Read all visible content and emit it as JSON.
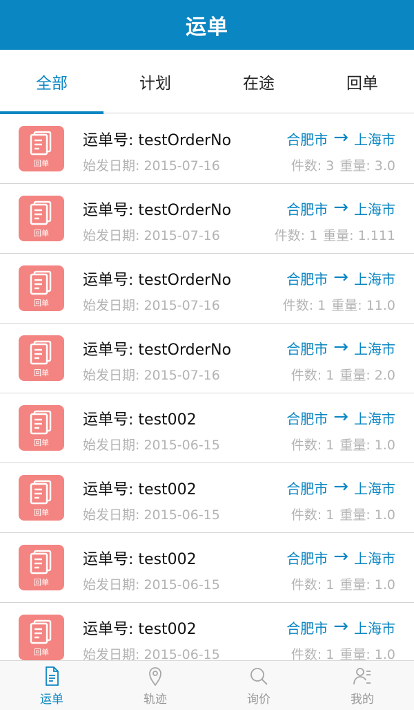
{
  "title": "运单",
  "tabs": [
    {
      "label": "全部",
      "active": true
    },
    {
      "label": "计划",
      "active": false
    },
    {
      "label": "在途",
      "active": false
    },
    {
      "label": "回单",
      "active": false
    }
  ],
  "orders": [
    {
      "icon_label": "回单",
      "order_no": "运单号: testOrderNo",
      "date": "始发日期:  2015-07-16",
      "from": "合肥市",
      "to": "上海市",
      "pieces": "件数: 3",
      "weight": "重量: 3.0"
    },
    {
      "icon_label": "回单",
      "order_no": "运单号: testOrderNo",
      "date": "始发日期:  2015-07-16",
      "from": "合肥市",
      "to": "上海市",
      "pieces": "件数: 1",
      "weight": "重量: 1.111"
    },
    {
      "icon_label": "回单",
      "order_no": "运单号: testOrderNo",
      "date": "始发日期:  2015-07-16",
      "from": "合肥市",
      "to": "上海市",
      "pieces": "件数: 1",
      "weight": "重量: 11.0"
    },
    {
      "icon_label": "回单",
      "order_no": "运单号: testOrderNo",
      "date": "始发日期:  2015-07-16",
      "from": "合肥市",
      "to": "上海市",
      "pieces": "件数: 1",
      "weight": "重量: 2.0"
    },
    {
      "icon_label": "回单",
      "order_no": "运单号: test002",
      "date": "始发日期:  2015-06-15",
      "from": "合肥市",
      "to": "上海市",
      "pieces": "件数: 1",
      "weight": "重量: 1.0"
    },
    {
      "icon_label": "回单",
      "order_no": "运单号: test002",
      "date": "始发日期:  2015-06-15",
      "from": "合肥市",
      "to": "上海市",
      "pieces": "件数: 1",
      "weight": "重量: 1.0"
    },
    {
      "icon_label": "回单",
      "order_no": "运单号: test002",
      "date": "始发日期:  2015-06-15",
      "from": "合肥市",
      "to": "上海市",
      "pieces": "件数: 1",
      "weight": "重量: 1.0"
    },
    {
      "icon_label": "回单",
      "order_no": "运单号: test002",
      "date": "始发日期:  2015-06-15",
      "from": "合肥市",
      "to": "上海市",
      "pieces": "件数: 1",
      "weight": "重量: 1.0"
    }
  ],
  "route_arrow": "→",
  "bottom_nav": [
    {
      "label": "运单",
      "icon": "document-icon",
      "active": true
    },
    {
      "label": "轨迹",
      "icon": "location-pin-icon",
      "active": false
    },
    {
      "label": "询价",
      "icon": "search-icon",
      "active": false
    },
    {
      "label": "我的",
      "icon": "user-profile-icon",
      "active": false
    }
  ],
  "colors": {
    "primary": "#0a86c2",
    "icon_bg": "#f38481",
    "muted_text": "#b3b3b3"
  }
}
